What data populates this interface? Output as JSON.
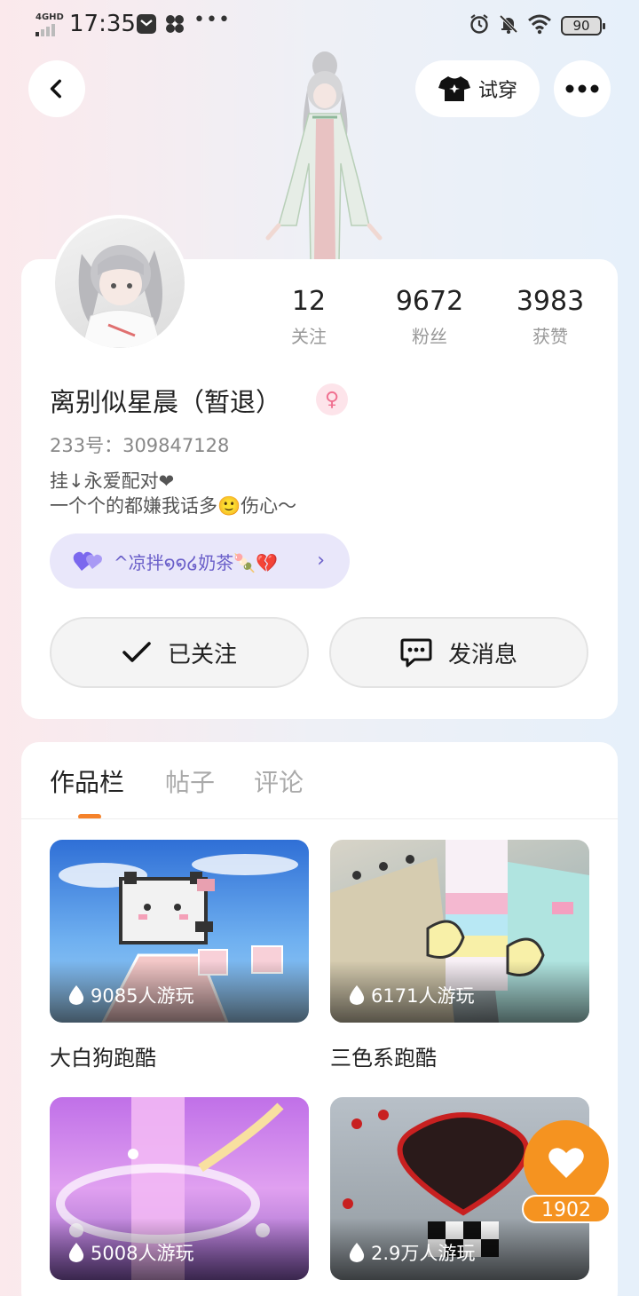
{
  "status_bar": {
    "network": "4GHD",
    "time": "17:35",
    "battery": "90"
  },
  "header": {
    "try_on_label": "试穿"
  },
  "profile": {
    "stats": [
      {
        "num": "12",
        "label": "关注"
      },
      {
        "num": "9672",
        "label": "粉丝"
      },
      {
        "num": "3983",
        "label": "获赞"
      }
    ],
    "nickname": "离别似星晨（暂退）",
    "uid": "233号：309847128",
    "bio_line1": "挂↓永爱配对❤",
    "bio_line2": "一个个的都嫌我话多🙂伤心～",
    "cp_tag": "^凉拌໑໑໒奶茶🍡💔",
    "follow_label": "已关注",
    "message_label": "发消息"
  },
  "tabs": [
    "作品栏",
    "帖子",
    "评论"
  ],
  "works": [
    {
      "title": "大白狗跑酷",
      "plays": "9085人游玩"
    },
    {
      "title": "三色系跑酷",
      "plays": "6171人游玩"
    },
    {
      "title": "",
      "plays": "5008人游玩"
    },
    {
      "title": "",
      "plays": "2.9万人游玩"
    }
  ],
  "like": {
    "count": "1902"
  },
  "colors": {
    "accent_orange": "#f59320",
    "tab_indicator": "#f5822a",
    "cp_purple": "#6a5fc9"
  }
}
